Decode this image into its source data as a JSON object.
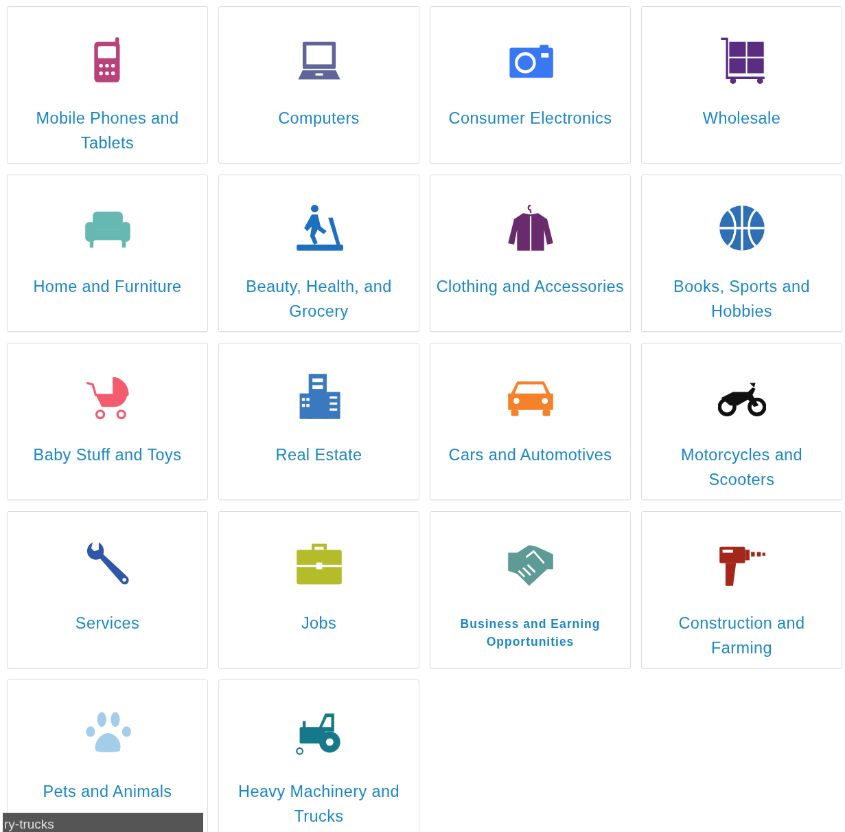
{
  "categories": [
    {
      "label": "Mobile Phones and Tablets",
      "kind": "phone",
      "color": "#b9427a"
    },
    {
      "label": "Computers",
      "kind": "laptop",
      "color": "#5f6598"
    },
    {
      "label": "Consumer Electronics",
      "kind": "camera",
      "color": "#3878f5"
    },
    {
      "label": "Wholesale",
      "kind": "cart",
      "color": "#5a2d82"
    },
    {
      "label": "Home and Furniture",
      "kind": "sofa",
      "color": "#66b8b3"
    },
    {
      "label": "Beauty, Health, and Grocery",
      "kind": "treadmill",
      "color": "#1d6fbf"
    },
    {
      "label": "Clothing and Accessories",
      "kind": "jacket",
      "color": "#6a2a6e"
    },
    {
      "label": "Books, Sports and Hobbies",
      "kind": "ball",
      "color": "#2f6fb6"
    },
    {
      "label": "Baby Stuff and Toys",
      "kind": "stroller",
      "color": "#f25c6e"
    },
    {
      "label": "Real Estate",
      "kind": "building",
      "color": "#3a79bf"
    },
    {
      "label": "Cars and Automotives",
      "kind": "car",
      "color": "#f5822a"
    },
    {
      "label": "Motorcycles and Scooters",
      "kind": "motorcycle",
      "color": "#111111"
    },
    {
      "label": "Services",
      "kind": "wrench",
      "color": "#2f57a8"
    },
    {
      "label": "Jobs",
      "kind": "briefcase",
      "color": "#b5bc2a"
    },
    {
      "label": "Business and Earning Opportunities",
      "kind": "handshake",
      "color": "#5e9a96"
    },
    {
      "label": "Construction and Farming",
      "kind": "drill",
      "color": "#a3271a"
    },
    {
      "label": "Pets and Animals",
      "kind": "paw",
      "color": "#a3cdea"
    },
    {
      "label": "Heavy Machinery and Trucks",
      "kind": "tractor",
      "color": "#16798a"
    }
  ],
  "status_tooltip": {
    "text": "ry-trucks"
  }
}
